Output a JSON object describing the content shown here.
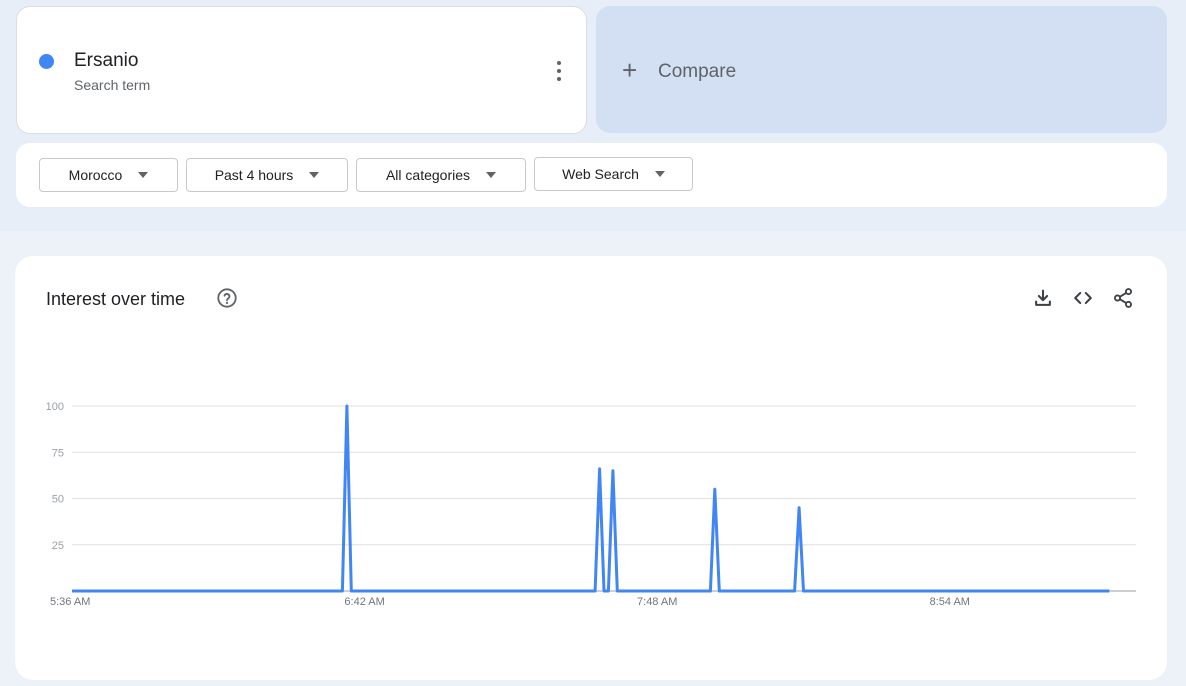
{
  "search_term": {
    "name": "Ersanio",
    "type": "Search term",
    "color": "#4285f4"
  },
  "compare": {
    "label": "Compare"
  },
  "filters": {
    "region": "Morocco",
    "time_range": "Past 4 hours",
    "category": "All categories",
    "search_type": "Web Search"
  },
  "interest_panel": {
    "title": "Interest over time",
    "icons": [
      "help-icon",
      "download-icon",
      "embed-code-icon",
      "share-icon"
    ]
  },
  "chart_data": {
    "type": "line",
    "x_tick_labels": [
      "5:36 AM",
      "6:42 AM",
      "7:48 AM",
      "8:54 AM"
    ],
    "y_tick_labels": [
      "100",
      "75",
      "50",
      "25"
    ],
    "ylim": [
      0,
      100
    ],
    "grid": true,
    "series": [
      {
        "color": "#4285f4",
        "x": [
          "5:36 AM",
          "6:37 AM",
          "6:38 AM",
          "6:39 AM",
          "7:34 AM",
          "7:35 AM",
          "7:36 AM",
          "7:37 AM",
          "7:38 AM",
          "7:39 AM",
          "7:40 AM",
          "8:00 AM",
          "8:01 AM",
          "8:02 AM",
          "8:19 AM",
          "8:20 AM",
          "8:21 AM",
          "9:30 AM"
        ],
        "values": [
          0,
          0,
          100,
          0,
          0,
          66,
          0,
          0,
          65,
          0,
          0,
          0,
          55,
          0,
          0,
          45,
          0,
          0
        ]
      }
    ]
  }
}
